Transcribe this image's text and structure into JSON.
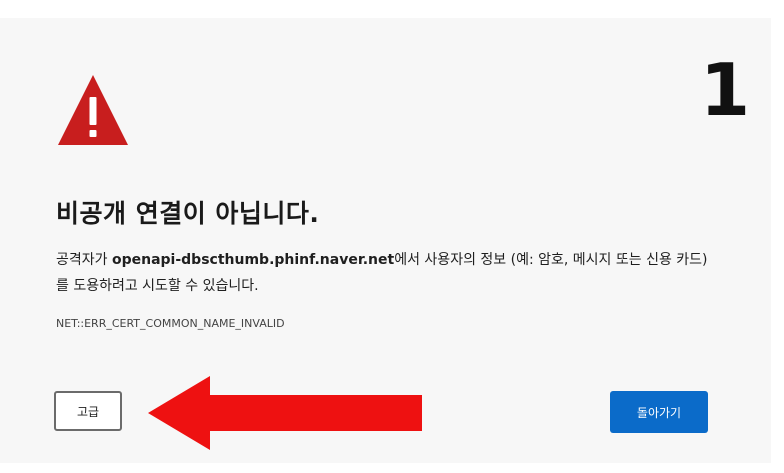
{
  "annotation": {
    "step_number": "1",
    "arrow_color": "#ee1111"
  },
  "warning": {
    "icon": "warning-triangle-icon",
    "icon_color": "#c81e1e"
  },
  "title": "비공개 연결이 아닙니다.",
  "description": {
    "prefix": "공격자가 ",
    "host": "openapi-dbscthumb.phinf.naver.net",
    "suffix": "에서 사용자의 정보 (예: 암호, 메시지 또는 신용 카드)를 도용하려고 시도할 수 있습니다."
  },
  "error_code": "NET::ERR_CERT_COMMON_NAME_INVALID",
  "buttons": {
    "advanced_label": "고급",
    "back_label": "돌아가기",
    "back_color": "#0b6bc9"
  }
}
